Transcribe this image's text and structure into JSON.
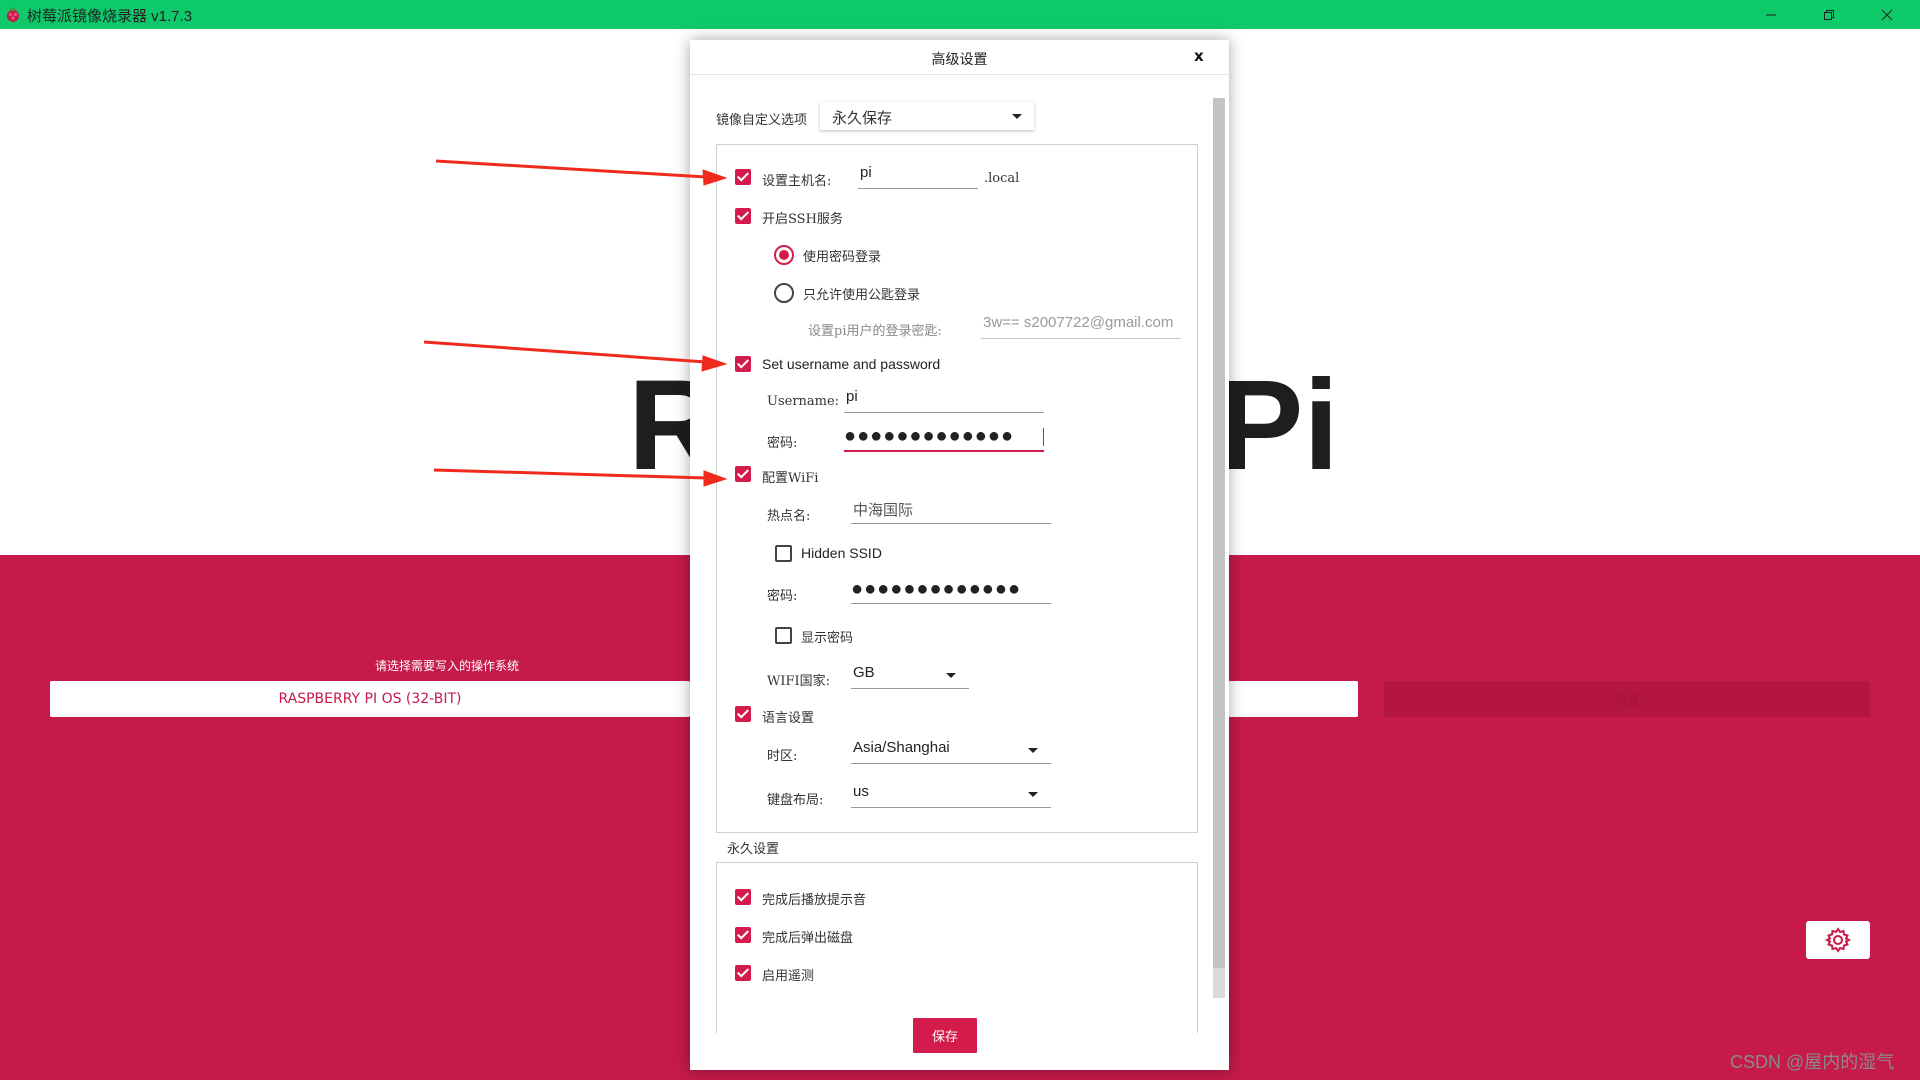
{
  "window": {
    "title": "树莓派镜像烧录器 v1.7.3",
    "min_icon": "minimize-icon",
    "max_icon": "restore-icon",
    "close_icon": "close-icon"
  },
  "main": {
    "hero_left": "R",
    "hero_right": "Pi",
    "os_caption": "请选择需要写入的操作系统",
    "os_button_label": "RASPBERRY PI OS (32-BIT)",
    "write_button_label": "烧录",
    "settings_icon": "gear-icon"
  },
  "dialog": {
    "title": "高级设置",
    "close_label": "x",
    "image_options_label": "镜像自定义选项",
    "image_options_value": "永久保存",
    "hostname": {
      "label": "设置主机名:",
      "value": "pi",
      "suffix": ".local"
    },
    "ssh": {
      "label": "开启SSH服务",
      "password_login": "使用密码登录",
      "pubkey_login": "只允许使用公匙登录",
      "key_label": "设置pi用户的登录密匙:",
      "key_value": "3w== s2007722@gmail.com"
    },
    "user": {
      "label": "Set username and password",
      "username_label": "Username:",
      "username_value": "pi",
      "password_label": "密码:",
      "password_value": "●●●●●●●●●●●●●"
    },
    "wifi": {
      "label": "配置WiFi",
      "ssid_label": "热点名:",
      "ssid_value": "中海国际",
      "hidden_ssid_label": "Hidden SSID",
      "password_label": "密码:",
      "password_value": "●●●●●●●●●●●●●",
      "show_password_label": "显示密码",
      "country_label": "WIFI国家:",
      "country_value": "GB"
    },
    "locale": {
      "label": "语言设置",
      "timezone_label": "时区:",
      "timezone_value": "Asia/Shanghai",
      "keyboard_label": "键盘布局:",
      "keyboard_value": "us"
    },
    "persistent": {
      "label": "永久设置",
      "beep": "完成后播放提示音",
      "eject": "完成后弹出磁盘",
      "telemetry": "启用遥测"
    },
    "save_label": "保存"
  },
  "watermark": "CSDN @屋内的湿气",
  "colors": {
    "titlebar": "#0ec96a",
    "accent": "#c51a4a",
    "checkbox": "#d31c4c",
    "arrow": "#f02a1c"
  }
}
